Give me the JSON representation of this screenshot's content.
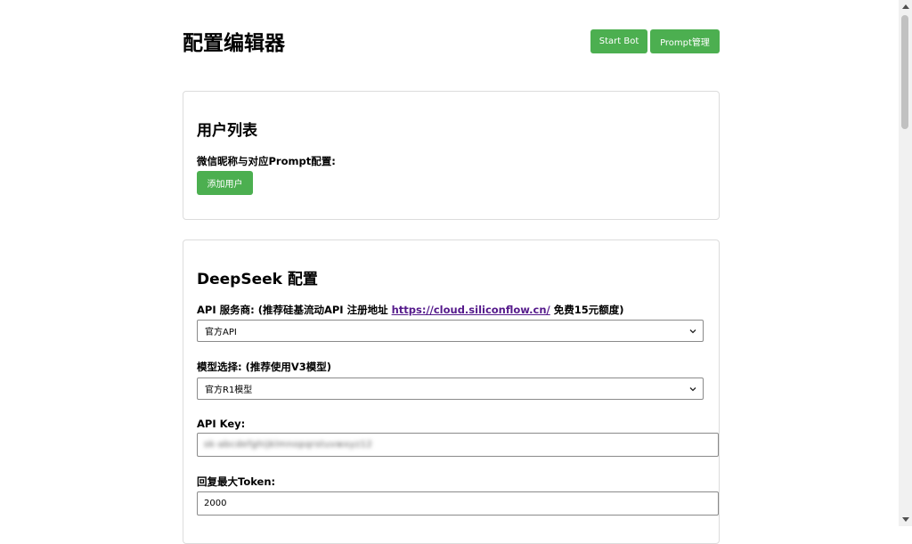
{
  "header": {
    "title": "配置编辑器",
    "start_bot_label": "Start Bot",
    "prompt_manage_label": "Prompt管理"
  },
  "user_list": {
    "heading": "用户列表",
    "mapping_label": "微信昵称与对应Prompt配置:",
    "add_user_label": "添加用户"
  },
  "deepseek": {
    "heading": "DeepSeek 配置",
    "provider_label_prefix": "API 服务商: (推荐硅基流动API 注册地址 ",
    "provider_link": "https://cloud.siliconflow.cn/",
    "provider_label_suffix": " 免费15元额度)",
    "provider_value": "官方API",
    "model_label": "模型选择: (推荐使用V3模型)",
    "model_value": "官方R1模型",
    "api_key_label": "API Key:",
    "api_key_value": "sk-abcdefghijklmnopqrstuvwxyz12",
    "max_token_label": "回复最大Token:",
    "max_token_value": "2000"
  },
  "colors": {
    "accent": "#4caf50",
    "link": "#551a8b"
  },
  "icons": {
    "select_arrow": "chevron-down-icon",
    "scroll_up": "arrow-up-icon",
    "scroll_down": "arrow-down-icon"
  }
}
